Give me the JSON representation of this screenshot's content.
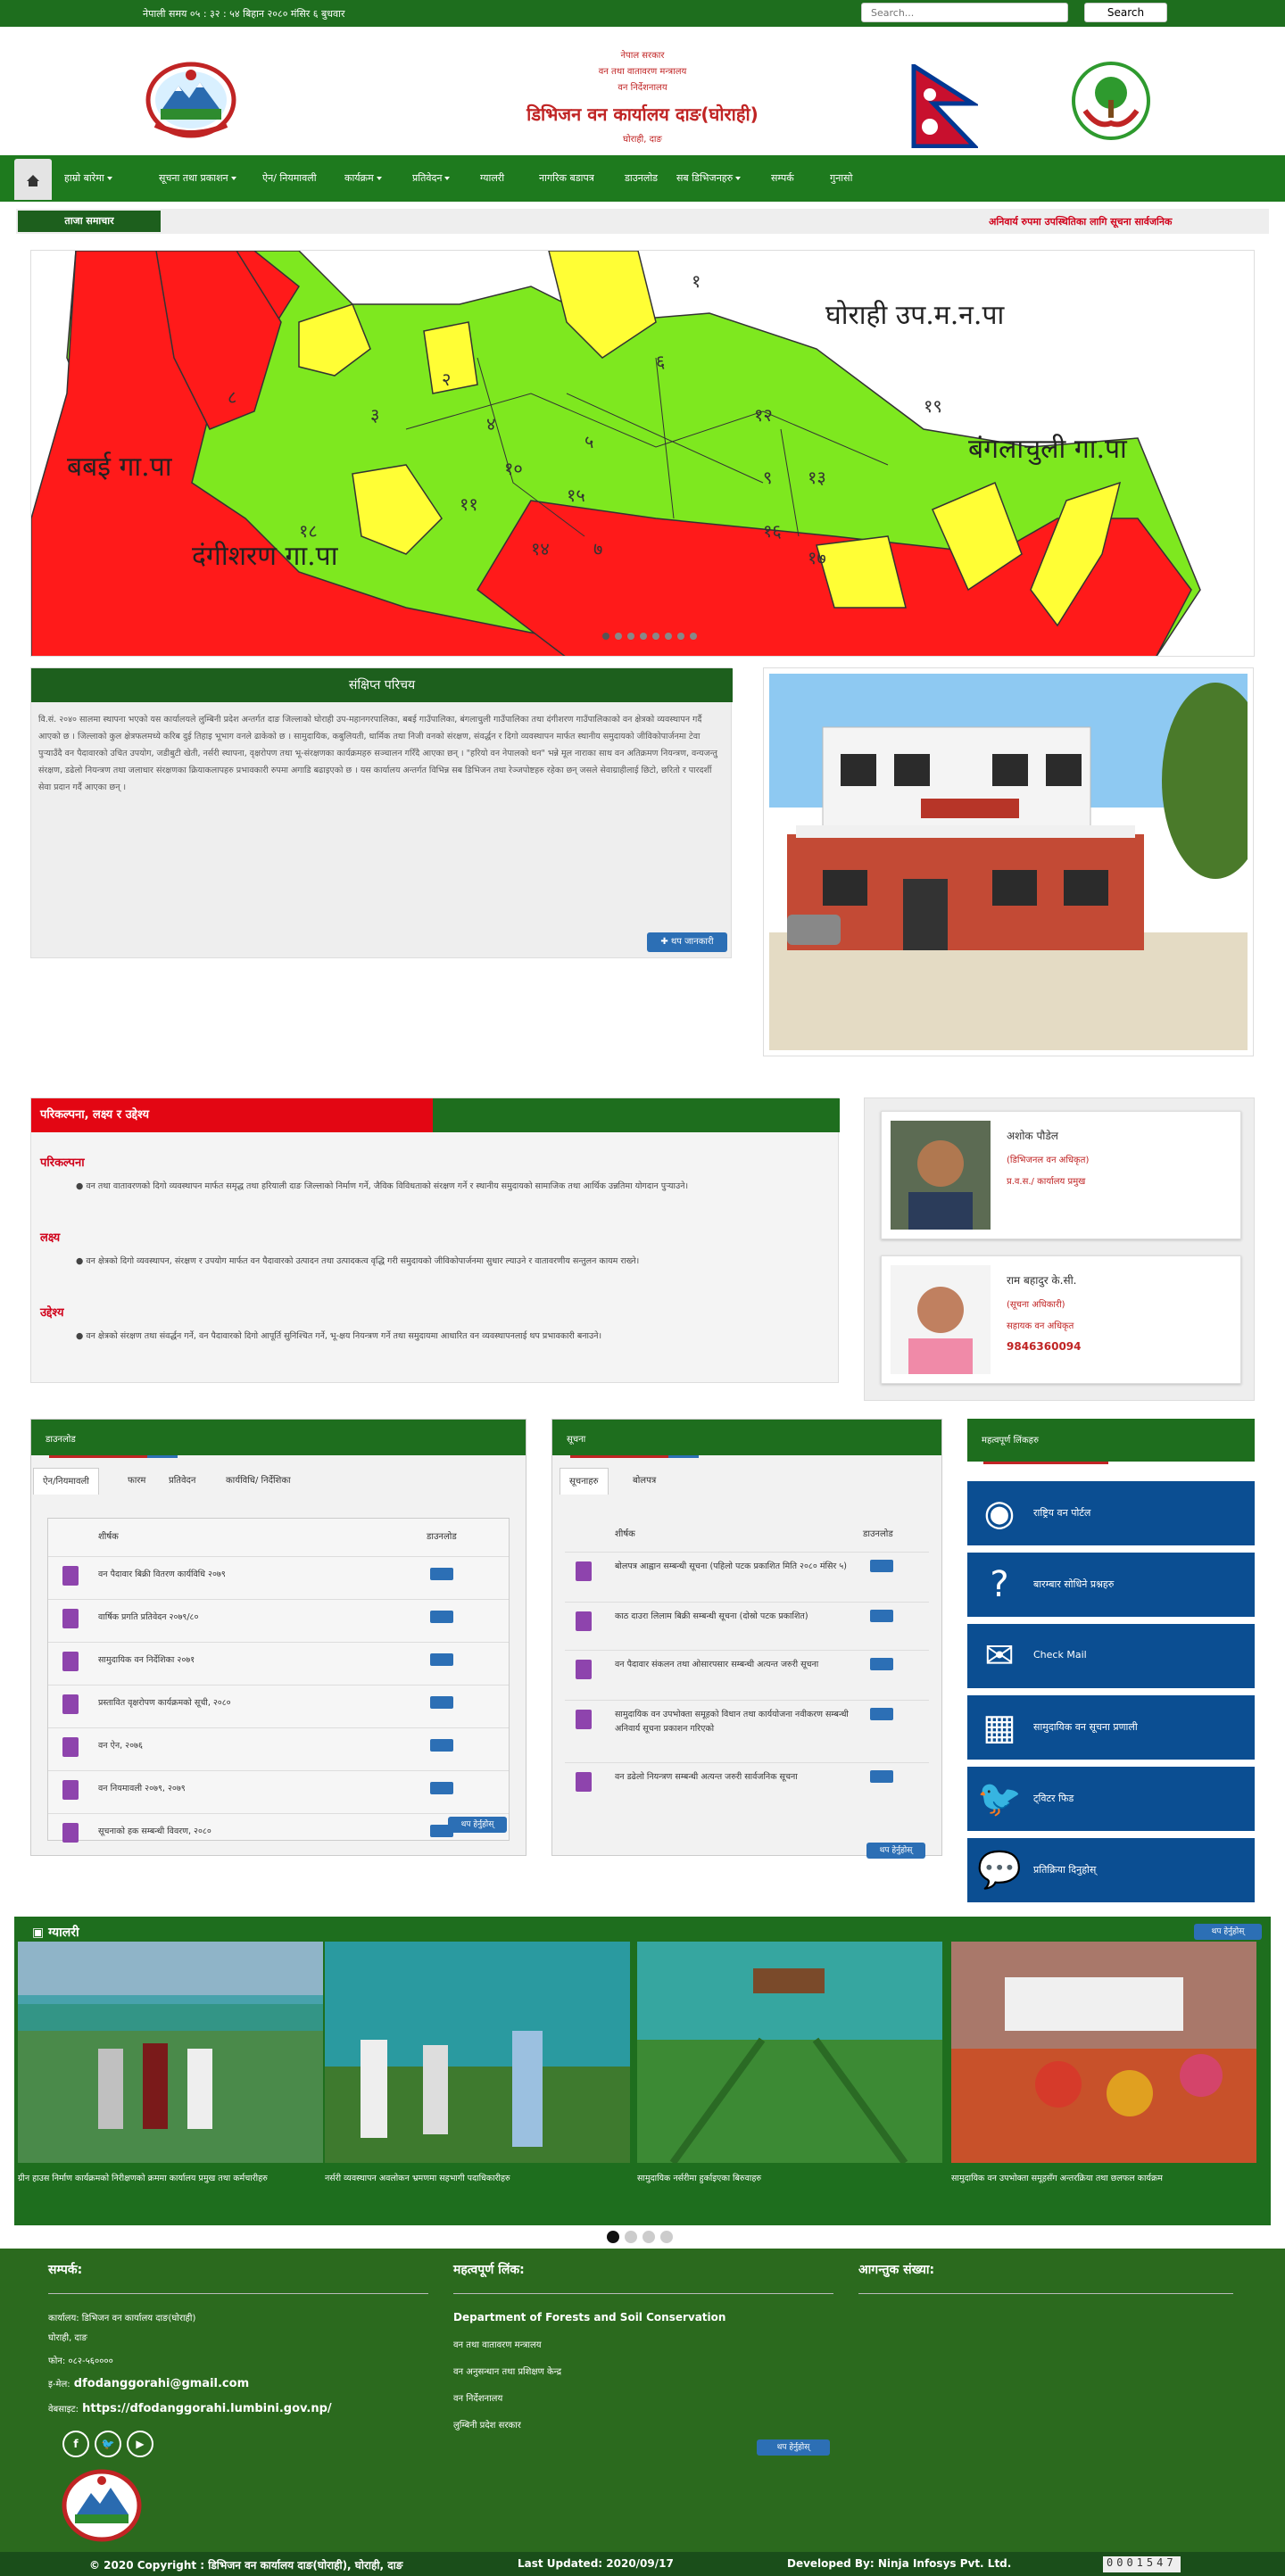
{
  "topbar": {
    "time": "नेपाली समय ०५ : ३२ : ५४ बिहान   २०८० मंसिर ६ बुधवार",
    "search_placeholder": "Search...",
    "search_button": "Search"
  },
  "header": {
    "line1": "नेपाल सरकार",
    "line2": "वन तथा वातावरण मन्त्रालय",
    "line3": "वन निर्देशनालय",
    "title": "डिभिजन वन कार्यालय दाङ(घोराही)",
    "location": "घोराही, दाङ"
  },
  "nav": {
    "items": [
      {
        "label": "हाम्रो बारेमा",
        "dropdown": true
      },
      {
        "label": "सूचना तथा प्रकाशन",
        "dropdown": true
      },
      {
        "label": "ऐन/ नियमावली",
        "dropdown": false
      },
      {
        "label": "कार्यक्रम",
        "dropdown": true
      },
      {
        "label": "प्रतिवेदन",
        "dropdown": true
      },
      {
        "label": "ग्यालरी",
        "dropdown": false
      },
      {
        "label": "नागरिक बडापत्र",
        "dropdown": false
      },
      {
        "label": "डाउनलोड",
        "dropdown": false
      },
      {
        "label": "सब डिभिजनहरु",
        "dropdown": true
      },
      {
        "label": "सम्पर्क",
        "dropdown": false
      },
      {
        "label": "गुनासो",
        "dropdown": false
      }
    ]
  },
  "ticker": {
    "label": "ताजा समाचार",
    "message": "अनिवार्य रुपमा उपस्थितिका लागि सूचना सार्वजनिक"
  },
  "slider": {
    "labels": [
      "घोराही उप.म.न.पा",
      "बंगलाचुली गा.पा",
      "बबई गा.पा",
      "दंगीशरण गा.पा"
    ],
    "ward_numbers": [
      "१",
      "२",
      "३",
      "४",
      "५",
      "६",
      "७",
      "८",
      "९",
      "१०",
      "११",
      "१२",
      "१३",
      "१४",
      "१५",
      "१६",
      "१७",
      "१८",
      "१९"
    ]
  },
  "intro": {
    "title": "संक्षिप्त परिचय",
    "body": "वि.सं. २०४० सालमा स्थापना भएको यस कार्यालयले लुम्बिनी प्रदेश अन्तर्गत दाङ जिल्लाको घोराही उप-महानगरपालिका, बबई गाउँपालिका, बंगलाचुली गाउँपालिका तथा दंगीशरण गाउँपालिकाको वन क्षेत्रको व्यवस्थापन गर्दै आएको छ । जिल्लाको कुल क्षेत्रफलमध्ये करिब दुई तिहाइ भूभाग वनले ढाकेको छ । सामुदायिक, कबुलियती, धार्मिक तथा निजी वनको संरक्षण, संवर्द्धन र दिगो व्यवस्थापन मार्फत स्थानीय समुदायको जीविकोपार्जनमा टेवा पुर्‍याउँदै वन पैदावारको उचित उपयोग, जडीबुटी खेती, नर्सरी स्थापना, वृक्षरोपण तथा भू-संरक्षणका कार्यक्रमहरु सञ्चालन गरिँदै आएका छन् । \"हरियो वन नेपालको धन\" भन्ने मूल नाराका साथ वन अतिक्रमण नियन्त्रण, वन्यजन्तु संरक्षण, डढेलो नियन्त्रण तथा जलाधार संरक्षणका क्रियाकलापहरु प्रभावकारी रुपमा अगाडि बढाइएको छ । यस कार्यालय अन्तर्गत विभिन्न सब डिभिजन तथा रेञ्जपोष्टहरु रहेका छन् जसले सेवाग्राहीलाई छिटो, छरितो र पारदर्शी सेवा प्रदान गर्दै आएका छन् ।",
    "more_button": "थप जानकारी"
  },
  "plans": {
    "title": "परिकल्पना, लक्ष्य र उद्देश्य",
    "sections": [
      {
        "heading": "परिकल्पना",
        "text": "वन तथा वातावरणको दिगो व्यवस्थापन मार्फत समृद्ध तथा हरियाली दाङ जिल्लाको निर्माण गर्ने, जैविक विविधताको संरक्षण गर्ने र स्थानीय समुदायको सामाजिक तथा आर्थिक उन्नतिमा योगदान पुर्‍याउने।"
      },
      {
        "heading": "लक्ष्य",
        "text": "वन क्षेत्रको दिगो व्यवस्थापन, संरक्षण र उपयोग मार्फत वन पैदावारको उत्पादन तथा उत्पादकत्व वृद्धि गरी समुदायको जीविकोपार्जनमा सुधार ल्याउने र वातावरणीय सन्तुलन कायम राख्ने।"
      },
      {
        "heading": "उद्देश्य",
        "text": "वन क्षेत्रको संरक्षण तथा संवर्द्धन गर्ने, वन पैदावारको दिगो आपूर्ति सुनिश्चित गर्ने, भू-क्षय नियन्त्रण गर्ने तथा समुदायमा आधारित वन व्यवस्थापनलाई थप प्रभावकारी बनाउने।"
      }
    ]
  },
  "officials": [
    {
      "name": "अशोक पौडेल",
      "role": "(डिभिजनल वन अधिकृत)",
      "detail": "प्र.व.स./ कार्यालय प्रमुख",
      "phone": ""
    },
    {
      "name": "राम बहादुर के.सी.",
      "role": "(सूचना अधिकारी)",
      "detail": "सहायक वन अधिकृत",
      "phone": "9846360094"
    }
  ],
  "downloads": {
    "title": "डाउनलोड",
    "tabs": [
      "ऐन/नियमावली",
      "फारम",
      "प्रतिवेदन",
      "कार्यविधि/ निर्देशिका"
    ],
    "col_title": "शीर्षक",
    "col_download": "डाउनलोड",
    "rows": [
      "वन पैदावार बिक्री वितरण कार्यविधि २०७९",
      "वार्षिक प्रगति प्रतिवेदन २०७९/८०",
      "सामुदायिक वन निर्देशिका २०७१",
      "प्रस्तावित वृक्षरोपण कार्यक्रमको सूची, २०८०",
      "वन ऐन, २०७६",
      "वन नियमावली २०७९, २०७९",
      "सूचनाको हक सम्बन्धी विवरण, २०८०"
    ],
    "more": "थप हेर्नुहोस्"
  },
  "notices": {
    "title": "सूचना",
    "tabs": [
      "सूचनाहरु",
      "बोलपत्र"
    ],
    "col_title": "शीर्षक",
    "col_download": "डाउनलोड",
    "rows": [
      "बोलपत्र आह्वान सम्बन्धी सूचना (पहिलो पटक प्रकाशित मिति २०८० मंसिर ५)",
      "काठ दाउरा लिलाम बिक्री सम्बन्धी सूचना (दोस्रो पटक प्रकाशित)",
      "वन पैदावार संकलन तथा ओसारपसार सम्बन्धी अत्यन्त जरुरी सूचना",
      "सामुदायिक वन उपभोक्ता समूहको विधान तथा कार्ययोजना नवीकरण सम्बन्धी अनिवार्य सूचना प्रकाशन गरिएको",
      "वन डढेलो नियन्त्रण सम्बन्धी अत्यन्त जरुरी सार्वजनिक सूचना"
    ],
    "more": "थप हेर्नुहोस्"
  },
  "links": {
    "title": "महत्वपूर्ण लिंकहरु",
    "items": [
      {
        "icon": "emblem-icon",
        "label": "राष्ट्रिय वन पोर्टल"
      },
      {
        "icon": "question-icon",
        "label": "बारम्बार सोधिने प्रश्नहरु"
      },
      {
        "icon": "mail-icon",
        "label": "Check Mail"
      },
      {
        "icon": "calculator-icon",
        "label": "सामुदायिक वन सूचना प्रणाली"
      },
      {
        "icon": "twitter-icon",
        "label": "ट्विटर फिड"
      },
      {
        "icon": "chat-icon",
        "label": "प्रतिक्रिया दिनुहोस्"
      }
    ]
  },
  "gallery": {
    "title": "ग्यालरी",
    "more": "थप हेर्नुहोस्",
    "items": [
      {
        "caption": "ग्रीन हाउस निर्माण कार्यक्रमको निरीक्षणको क्रममा कार्यालय प्रमुख तथा कर्मचारीहरु"
      },
      {
        "caption": "नर्सरी व्यवस्थापन अवलोकन भ्रमणमा सहभागी पदाधिकारीहरु"
      },
      {
        "caption": "सामुदायिक नर्सरीमा हुर्काइएका बिरुवाहरु"
      },
      {
        "caption": "सामुदायिक वन उपभोक्ता समूहसँग अन्तरक्रिया तथा छलफल कार्यक्रम"
      }
    ]
  },
  "footer": {
    "col1_title": "सम्पर्क:",
    "office": "कार्यालय: डिभिजन वन कार्यालय दाङ(घोराही)",
    "address": "घोराही, दाङ",
    "phone": "फोन: ०८२-५६००००",
    "email_label": "इ-मेल:",
    "email": "dfodanggorahi@gmail.com",
    "website_label": "वेबसाइट:",
    "website": "https://dfodanggorahi.lumbini.gov.np/",
    "col2_title": "महत्वपूर्ण लिंक:",
    "links": [
      "Department of Forests and Soil Conservation",
      "वन तथा वातावरण मन्त्रालय",
      "वन अनुसन्धान तथा प्रशिक्षण केन्द्र",
      "वन निर्देशनालय",
      "लुम्बिनी प्रदेश सरकार"
    ],
    "links_more": "थप हेर्नुहोस्",
    "col3_title": "आगन्तुक संख्या:"
  },
  "copyright": {
    "text": "© 2020 Copyright : डिभिजन वन कार्यालय दाङ(घोराही), घोराही, दाङ",
    "updated": "Last Updated: 2020/09/17",
    "developer": "Developed By: Ninja Infosys Pvt. Ltd.",
    "counter": "0001547"
  },
  "colors": {
    "brand_green": "#1e6e1e",
    "accent_red": "#c02424",
    "link_blue": "#0b4e92"
  }
}
